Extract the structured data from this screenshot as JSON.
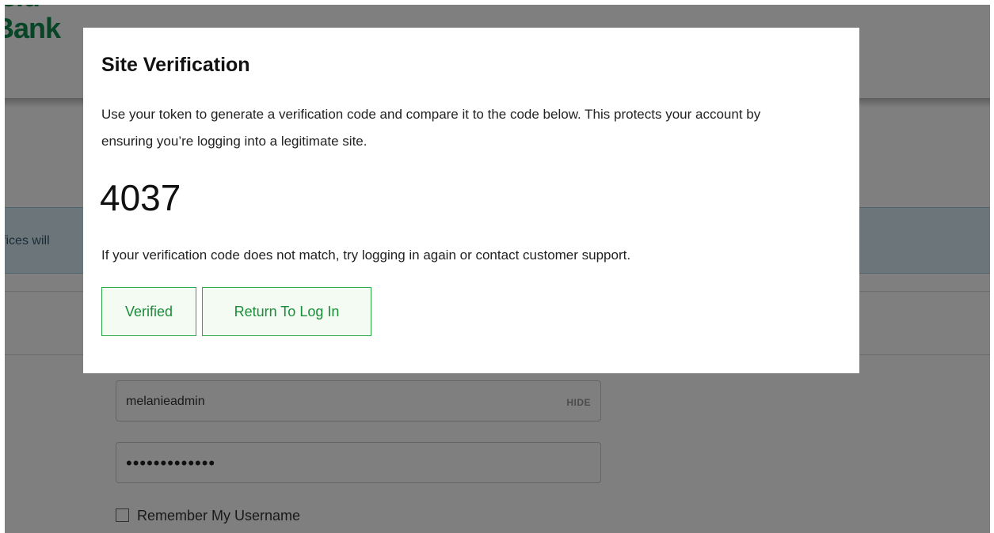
{
  "logo": {
    "line1": "ield",
    "line2": "Bank"
  },
  "notice": {
    "text": "offices will"
  },
  "login": {
    "username_value": "melanieadmin",
    "hide_label": "HIDE",
    "password_mask": "•••••••••••••",
    "remember_label": "Remember My Username"
  },
  "modal": {
    "title": "Site Verification",
    "body": "Use your token to generate a verification code and compare it to the code below. This protects your account by ensuring you’re logging into a legitimate site.",
    "code": "4037",
    "mismatch_text": "If your verification code does not match, try logging in again or contact customer support.",
    "verified_button": "Verified",
    "return_button": "Return To Log In"
  },
  "colors": {
    "brand_green": "#0e8a4c",
    "button_border": "#2aa84a",
    "notice_bg": "#d8ecf4",
    "overlay": "rgba(0,0,0,0.5)"
  }
}
